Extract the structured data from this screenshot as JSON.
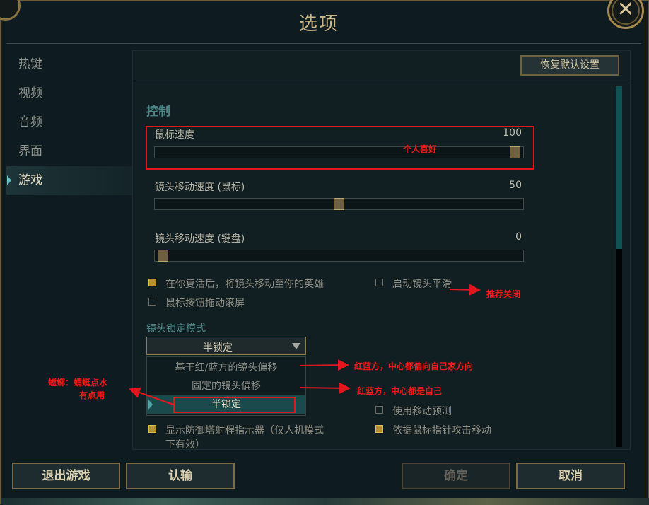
{
  "window": {
    "title": "选项",
    "close_symbol": "✕"
  },
  "sidebar": {
    "items": [
      {
        "label": "热键",
        "active": false
      },
      {
        "label": "视频",
        "active": false
      },
      {
        "label": "音频",
        "active": false
      },
      {
        "label": "界面",
        "active": false
      },
      {
        "label": "游戏",
        "active": true
      }
    ]
  },
  "panel": {
    "restore_label": "恢复默认设置",
    "section_title": "控制",
    "sliders": [
      {
        "label": "鼠标速度",
        "value": "100",
        "fraction": 1.0
      },
      {
        "label": "镜头移动速度 (鼠标)",
        "value": "50",
        "fraction": 0.5
      },
      {
        "label": "镜头移动速度 (键盘)",
        "value": "0",
        "fraction": 0.0
      }
    ],
    "checkboxes": {
      "camera_to_hero": {
        "label": "在你复活后，将镜头移动至你的英雄",
        "checked": true
      },
      "camera_smooth": {
        "label": "启动镜头平滑",
        "checked": false
      },
      "mouse_drag_scroll": {
        "label": "鼠标按钮拖动滚屏",
        "checked": false
      },
      "move_prediction": {
        "label": "使用移动预测",
        "checked": false
      },
      "tower_range": {
        "label": "显示防御塔射程指示器（仅人机模式",
        "label_line2": "下有效）",
        "checked": true
      },
      "attack_move_cursor": {
        "label": "依据鼠标指针攻击移动",
        "checked": true
      }
    },
    "lock_mode": {
      "label": "镜头锁定模式",
      "selected": "半锁定",
      "options": [
        "基于红/蓝方的镜头偏移",
        "固定的镜头偏移",
        "半锁定"
      ]
    }
  },
  "footer": {
    "exit_label": "退出游戏",
    "surrender_label": "认输",
    "confirm_label": "确定",
    "cancel_label": "取消"
  },
  "annotations": {
    "personal_preference": "个人喜好",
    "recommend_off": "推荐关闭",
    "red_blue_offset": "红蓝方，中心都偏向自己家方向",
    "red_blue_center": "红蓝方，中心都是自己",
    "mantis_line1": "螳螂：蜻蜓点水",
    "mantis_line2": "有点用",
    "color": "#e4151c"
  }
}
